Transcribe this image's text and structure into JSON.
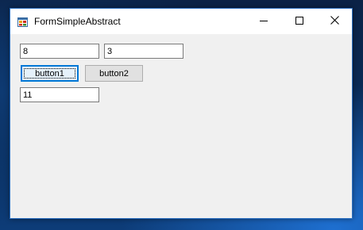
{
  "window": {
    "title": "FormSimpleAbstract",
    "app_icon": "winforms-app-icon",
    "caption_buttons": {
      "minimize_icon": "minimize-icon",
      "maximize_icon": "maximize-icon",
      "close_icon": "close-icon"
    }
  },
  "form": {
    "textbox1": {
      "value": "8"
    },
    "textbox2": {
      "value": "3"
    },
    "button1": {
      "label": "button1"
    },
    "button2": {
      "label": "button2"
    },
    "textbox3": {
      "value": "11"
    }
  },
  "colors": {
    "accent": "#0078d7",
    "window_border": "#2b6fc0",
    "client_background": "#f0f0f0"
  }
}
